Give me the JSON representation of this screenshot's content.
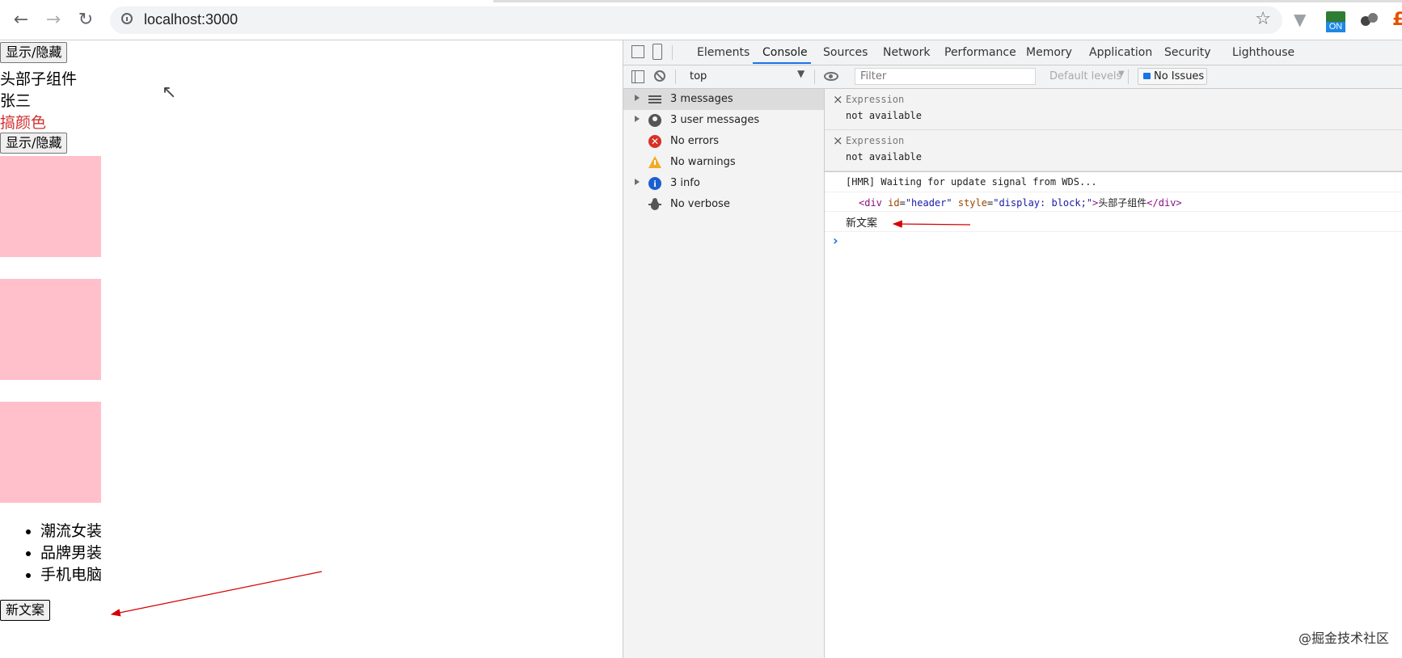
{
  "browser": {
    "url": "localhost:3000",
    "extension_badge": "ON"
  },
  "page": {
    "toggle_button_1": "显示/隐藏",
    "header_text": "头部子组件",
    "name_text": "张三",
    "color_text": "搞颜色",
    "toggle_button_2": "显示/隐藏",
    "list_items": [
      "潮流女装",
      "品牌男装",
      "手机电脑"
    ],
    "new_copy_button": "新文案",
    "colors": {
      "box": "#ffc0cb",
      "color_text": "#d32f2f",
      "annotation_arrow": "#d50000"
    }
  },
  "devtools": {
    "tabs": [
      "Elements",
      "Console",
      "Sources",
      "Network",
      "Performance",
      "Memory",
      "Application",
      "Security",
      "Lighthouse"
    ],
    "active_tab": "Console",
    "toolbar": {
      "context": "top",
      "filter_placeholder": "Filter",
      "levels": "Default levels",
      "issues": "No Issues"
    },
    "sidebar": [
      {
        "label": "3 messages",
        "icon": "list-icon",
        "expandable": true,
        "selected": true
      },
      {
        "label": "3 user messages",
        "icon": "user-icon",
        "expandable": true
      },
      {
        "label": "No errors",
        "icon": "error-icon",
        "expandable": false
      },
      {
        "label": "No warnings",
        "icon": "warning-icon",
        "expandable": false
      },
      {
        "label": "3 info",
        "icon": "info-icon",
        "expandable": true
      },
      {
        "label": "No verbose",
        "icon": "bug-icon",
        "expandable": false
      }
    ],
    "expressions": [
      {
        "title": "Expression",
        "value": "not available"
      },
      {
        "title": "Expression",
        "value": "not available"
      }
    ],
    "console": {
      "hmr_line": "[HMR] Waiting for update signal from WDS...",
      "element_tag_open": "<div",
      "attr1_name": "id",
      "attr1_value": "\"header\"",
      "attr2_name": "style",
      "attr2_value": "\"display: block;\"",
      "element_text": "头部子组件",
      "element_tag_close": "</div>",
      "log_line": "新文案",
      "prompt": "›"
    }
  },
  "watermark": "@掘金技术社区"
}
